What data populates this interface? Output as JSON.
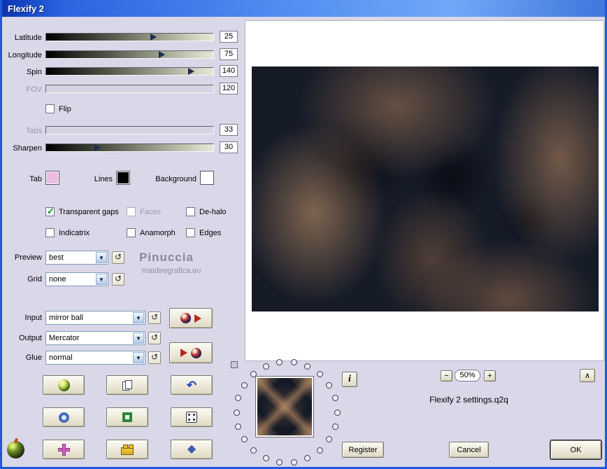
{
  "window": {
    "title": "Flexify 2"
  },
  "sliders": [
    {
      "label": "Latitude",
      "value": "25",
      "percent": 63.5,
      "enabled": true
    },
    {
      "label": "Longitude",
      "value": "75",
      "percent": 68.5,
      "enabled": true
    },
    {
      "label": "Spin",
      "value": "140",
      "percent": 86,
      "enabled": true
    },
    {
      "label": "FOV",
      "value": "120",
      "percent": 0,
      "enabled": false
    },
    {
      "label": "Tabs",
      "value": "33",
      "percent": 0,
      "enabled": false
    },
    {
      "label": "Sharpen",
      "value": "30",
      "percent": 30,
      "enabled": true
    }
  ],
  "flip": {
    "label": "Flip",
    "checked": false
  },
  "swatches": [
    {
      "label": "Tab",
      "color": "#edbce2"
    },
    {
      "label": "Lines",
      "color": "#000000"
    },
    {
      "label": "Background",
      "color": "#ffffff"
    }
  ],
  "checkboxes": [
    {
      "label": "Transparent gaps",
      "checked": true,
      "enabled": true
    },
    {
      "label": "Faces",
      "checked": false,
      "enabled": false
    },
    {
      "label": "De-halo",
      "checked": false,
      "enabled": true
    },
    {
      "label": "Indicatrix",
      "checked": false,
      "enabled": true
    },
    {
      "label": "Anamorph",
      "checked": false,
      "enabled": true
    },
    {
      "label": "Edges",
      "checked": false,
      "enabled": true
    }
  ],
  "combos": {
    "preview": {
      "label": "Preview",
      "value": "best"
    },
    "grid": {
      "label": "Grid",
      "value": "none"
    },
    "input": {
      "label": "Input",
      "value": "mirror ball"
    },
    "output": {
      "label": "Output",
      "value": "Mercator"
    },
    "glue": {
      "label": "Glue",
      "value": "normal"
    }
  },
  "watermark": {
    "line1": "Pinuccia",
    "line2": "maidiregrafica.eu"
  },
  "preview_panel": {
    "zoom_out": "−",
    "zoom_value": "50%",
    "zoom_in": "+",
    "collapse": "∧",
    "info": "i",
    "settings_file": "Flexify 2 settings.q2q"
  },
  "actions": {
    "register": "Register",
    "cancel": "Cancel",
    "ok": "OK"
  },
  "icons": {
    "combo_arrow": "▼",
    "reset": "↺",
    "undo": "↶",
    "gem": "◆"
  }
}
